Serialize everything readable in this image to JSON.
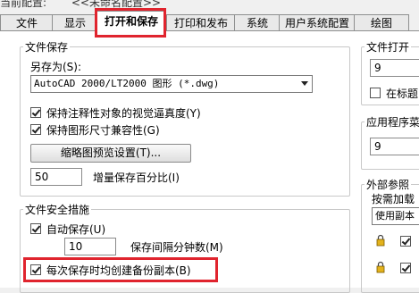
{
  "current_config": {
    "label": "当前配置:",
    "value": "<<未命名配置>>"
  },
  "tabs": [
    {
      "label": "文件"
    },
    {
      "label": "显示"
    },
    {
      "label": "打开和保存"
    },
    {
      "label": "打印和发布"
    },
    {
      "label": "系统"
    },
    {
      "label": "用户系统配置"
    },
    {
      "label": "绘图"
    }
  ],
  "file_save": {
    "title": "文件保存",
    "save_as_label": "另存为(S):",
    "save_as_value": "AutoCAD 2000/LT2000 图形 (*.dwg)",
    "keep_annotative": "保持注释性对象的视觉逼真度(Y)",
    "keep_drawing_size": "保持图形尺寸兼容性(G)",
    "thumbnail_button": "缩略图预览设置(T)...",
    "incremental_value": "50",
    "incremental_label": "增量保存百分比(I)"
  },
  "safety": {
    "title": "文件安全措施",
    "autosave_label": "自动保存(U)",
    "interval_value": "10",
    "interval_label": "保存间隔分钟数(M)",
    "backup_label": "每次保存时均创建备份副本(B)"
  },
  "file_open": {
    "title": "文件打开",
    "value": "9",
    "check_label": "在标题"
  },
  "app_menu": {
    "title": "应用程序菜",
    "value": "9"
  },
  "xref": {
    "title": "外部参照",
    "demand_label": "按需加载",
    "demand_value": "使用副本"
  },
  "checks": {
    "keep_annotative": true,
    "keep_drawing_size": true,
    "autosave": true,
    "backup": true,
    "title_full_path": false,
    "xref_1": true,
    "xref_2": true
  }
}
